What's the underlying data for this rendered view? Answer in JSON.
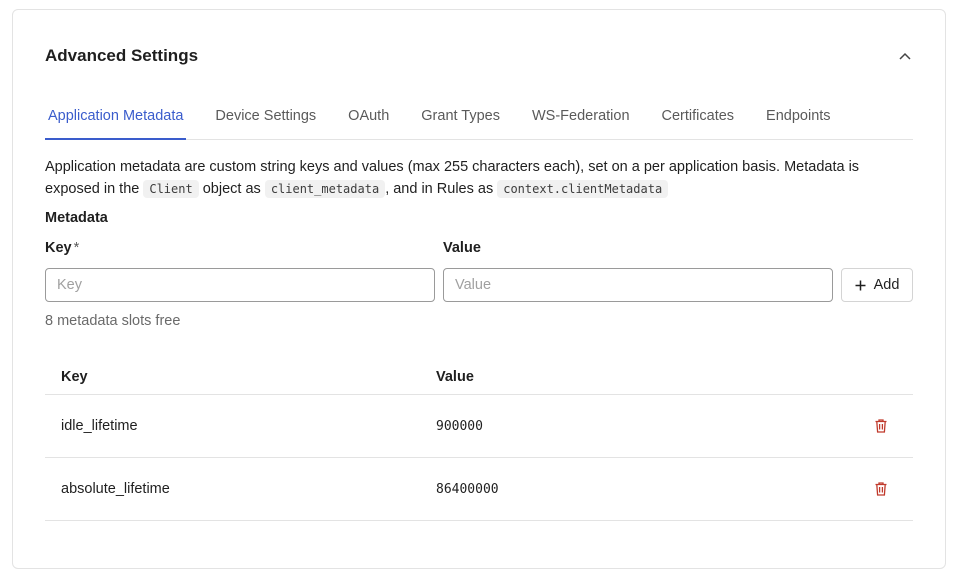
{
  "card": {
    "title": "Advanced Settings"
  },
  "tabs": [
    {
      "label": "Application Metadata",
      "active": true
    },
    {
      "label": "Device Settings",
      "active": false
    },
    {
      "label": "OAuth",
      "active": false
    },
    {
      "label": "Grant Types",
      "active": false
    },
    {
      "label": "WS-Federation",
      "active": false
    },
    {
      "label": "Certificates",
      "active": false
    },
    {
      "label": "Endpoints",
      "active": false
    }
  ],
  "description": {
    "text1": "Application metadata are custom string keys and values (max 255 characters each), set on a per application basis. Metadata is exposed in the ",
    "code1": "Client",
    "text2": " object as ",
    "code2": "client_metadata",
    "text3": ", and in Rules as ",
    "code3": "context.clientMetadata"
  },
  "form": {
    "section_label": "Metadata",
    "key_label": "Key",
    "required_mark": "*",
    "value_label": "Value",
    "key_placeholder": "Key",
    "value_placeholder": "Value",
    "add_label": "Add",
    "slots_text": "8 metadata slots free"
  },
  "table": {
    "headers": {
      "key": "Key",
      "value": "Value"
    },
    "rows": [
      {
        "key": "idle_lifetime",
        "value": "900000"
      },
      {
        "key": "absolute_lifetime",
        "value": "86400000"
      }
    ]
  },
  "colors": {
    "accent": "#3a5ccc",
    "danger": "#c0392b"
  }
}
